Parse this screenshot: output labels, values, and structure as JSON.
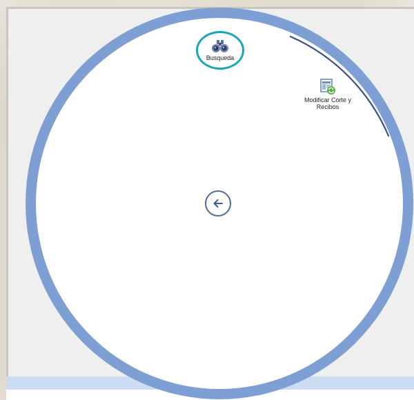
{
  "menu": {
    "items": [
      {
        "label": "Busqueda",
        "icon": "binoculars-icon",
        "selected": true
      },
      {
        "label": "Modificar Corte y Recibos",
        "icon": "modify-document-icon",
        "selected": false
      }
    ],
    "back_icon": "arrow-left-icon"
  },
  "colors": {
    "ring": "#7d9fd4",
    "selection_ring": "#18a7b5",
    "arc_indicator": "#3a4f86",
    "bottom_bar": "#cbdcf3"
  }
}
